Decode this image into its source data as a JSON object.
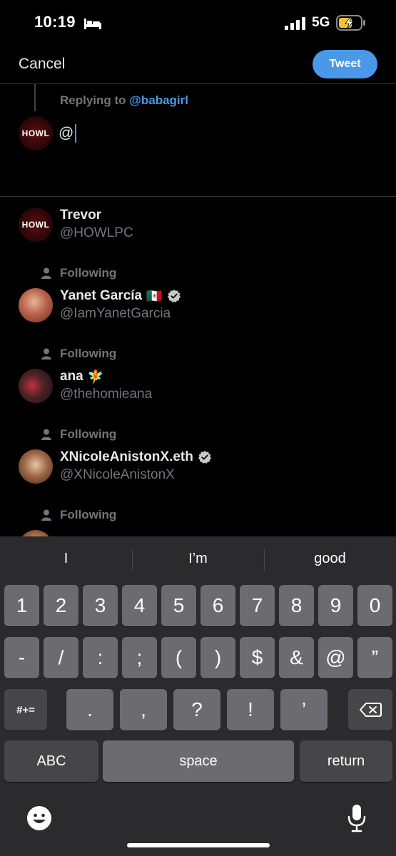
{
  "status_bar": {
    "time": "10:19",
    "network": "5G"
  },
  "nav": {
    "cancel_label": "Cancel",
    "tweet_label": "Tweet"
  },
  "compose": {
    "replying_prefix": "Replying to",
    "replying_handle": "@babagirl",
    "avatar_text": "HOWL",
    "input_value": "@"
  },
  "suggestions": [
    {
      "name": "Trevor",
      "handle": "@HOWLPC",
      "following": "",
      "avatar_text": "HOWL",
      "verified": false,
      "emoji": ""
    },
    {
      "name": "Yanet García",
      "handle": "@IamYanetGarcia",
      "following": "Following",
      "verified": true,
      "emoji": "🇲🇽"
    },
    {
      "name": "ana",
      "handle": "@thehomieana",
      "following": "Following",
      "verified": false,
      "emoji": "🧚"
    },
    {
      "name": "XNicoleAnistonX.eth",
      "handle": "@XNicoleAnistonX",
      "following": "Following",
      "verified": true,
      "emoji": ""
    },
    {
      "following": "Following"
    }
  ],
  "keyboard": {
    "predictions": [
      "I",
      "I’m",
      "good"
    ],
    "row1": [
      "1",
      "2",
      "3",
      "4",
      "5",
      "6",
      "7",
      "8",
      "9",
      "0"
    ],
    "row2": [
      "-",
      "/",
      ":",
      ";",
      "(",
      ")",
      "$",
      "&",
      "@",
      "”"
    ],
    "row3_mod": "#+=",
    "row3": [
      ".",
      ",",
      "?",
      "!",
      "’"
    ],
    "abc": "ABC",
    "space": "space",
    "return": "return"
  },
  "colors": {
    "accent": "#4a99e9",
    "background": "#000000",
    "keyboard": "#2b2b2d",
    "key": "#6c6c70",
    "muted": "#71767b"
  }
}
